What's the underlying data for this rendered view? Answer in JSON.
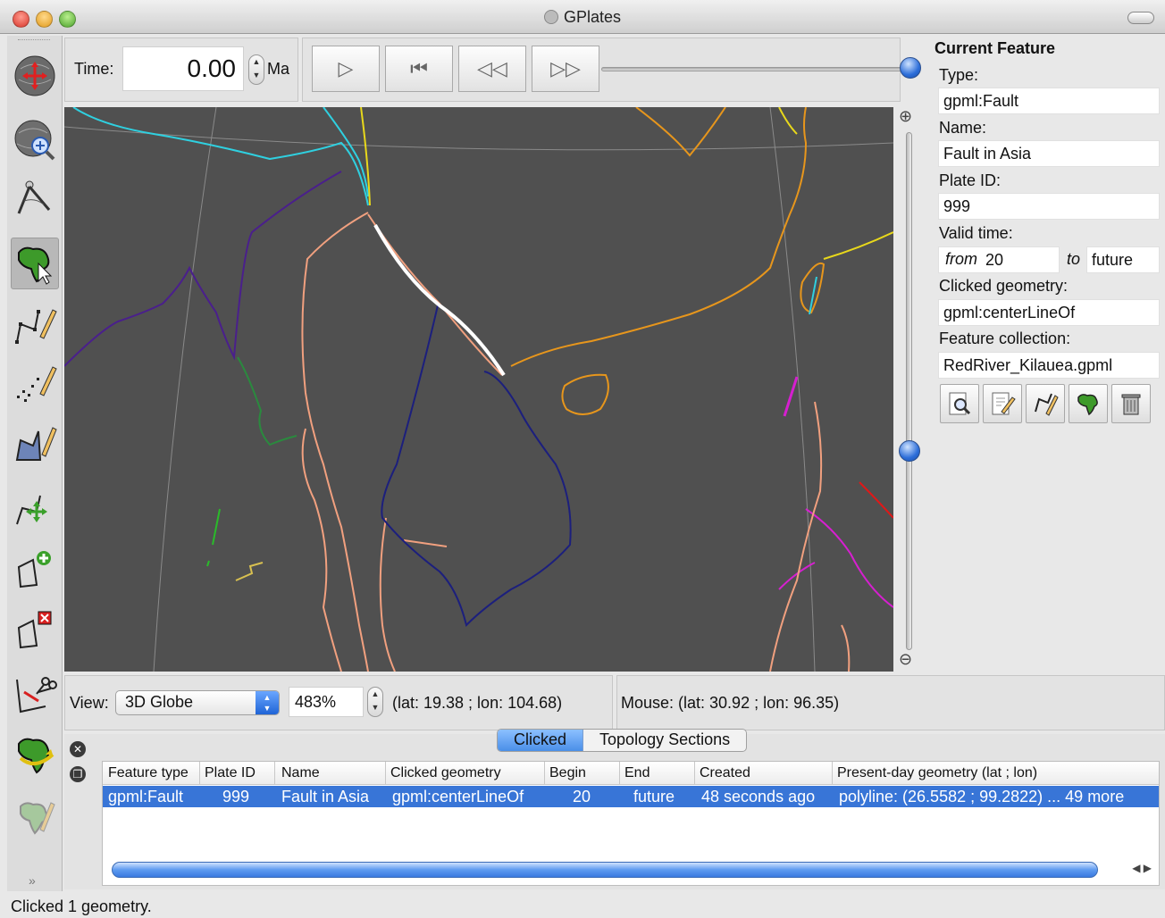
{
  "window": {
    "title": "GPlates"
  },
  "time_control": {
    "label": "Time:",
    "value": "0.00",
    "unit": "Ma",
    "slider_position": 1.0
  },
  "playback": {
    "buttons": [
      "play",
      "reset",
      "rewind",
      "fast-forward"
    ]
  },
  "tools": [
    "drag-globe-tool",
    "zoom-globe-tool",
    "measure-distance-tool",
    "choose-feature-tool",
    "digitise-polyline-tool",
    "digitise-multipoint-tool",
    "digitise-polygon-tool",
    "move-vertex-tool",
    "insert-vertex-tool",
    "delete-vertex-tool",
    "split-feature-tool",
    "manipulate-pole-tool",
    "build-topology-tool"
  ],
  "current_feature": {
    "heading": "Current Feature",
    "type_label": "Type:",
    "type_value": "gpml:Fault",
    "name_label": "Name:",
    "name_value": "Fault in Asia",
    "plate_id_label": "Plate ID:",
    "plate_id_value": "999",
    "valid_time_label": "Valid time:",
    "from_label": "from",
    "from_value": "20",
    "to_label": "to",
    "to_value": "future",
    "geometry_label": "Clicked geometry:",
    "geometry_value": "gpml:centerLineOf",
    "collection_label": "Feature collection:",
    "collection_value": "RedRiver_Kilauea.gpml",
    "action_icons": [
      "query-feature-icon",
      "edit-feature-icon",
      "edit-geometry-icon",
      "reconstruct-icon",
      "delete-feature-icon"
    ]
  },
  "view": {
    "label": "View:",
    "projection": "3D Globe",
    "zoom": "483%",
    "camera_coords": "(lat: 19.38 ; lon: 104.68)",
    "mouse_coords": "Mouse: (lat: 30.92 ; lon: 96.35)",
    "zoom_slider_level": 0.38
  },
  "bottom_panel": {
    "tabs": [
      "Clicked",
      "Topology Sections"
    ],
    "columns": [
      "Feature type",
      "Plate ID",
      "Name",
      "Clicked geometry",
      "Begin",
      "End",
      "Created",
      "Present-day geometry (lat ; lon)"
    ],
    "rows": [
      [
        "gpml:Fault",
        "999",
        "Fault in Asia",
        "gpml:centerLineOf",
        "20",
        "future",
        "48 seconds ago",
        "polyline: (26.5582 ; 99.2822) ... 49 more"
      ]
    ]
  },
  "status": "Clicked 1 geometry.",
  "colors": {
    "map_background": "#505050",
    "selection": "#3875d7",
    "china": "#e7961c",
    "indochina": "#f1a07f",
    "vietnam": "#1c1f7d",
    "fault": "#ffffff",
    "india": "#4a1f8c",
    "cyan": "#2fd0e0",
    "yellow": "#e8d81b",
    "green": "#2a8a3e",
    "magenta": "#d61fd0",
    "red": "#e01818"
  }
}
